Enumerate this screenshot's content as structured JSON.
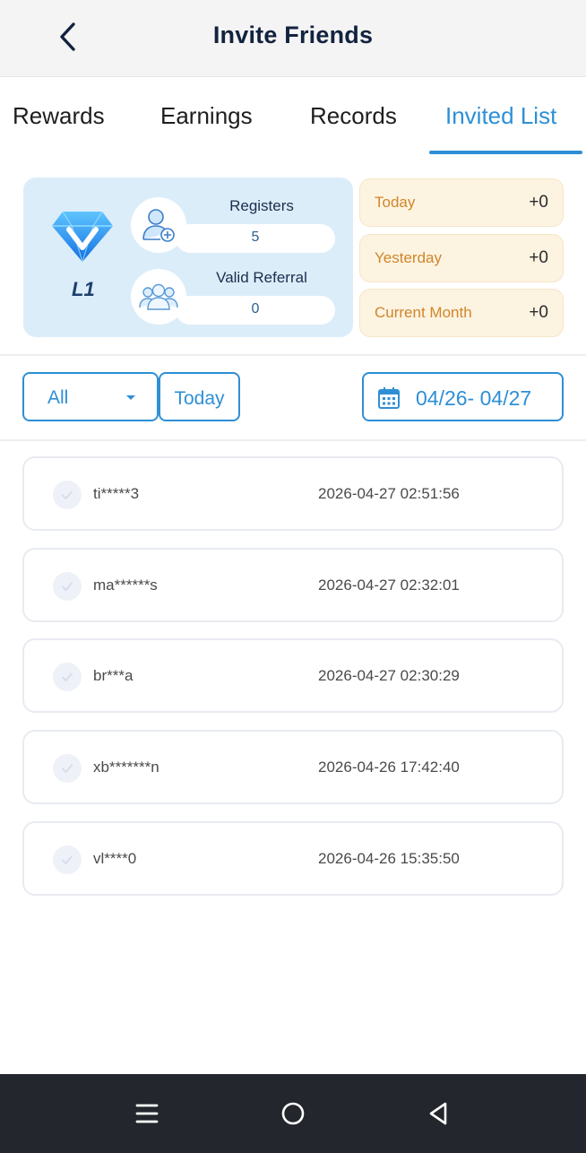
{
  "header": {
    "title": "Invite Friends",
    "back_icon": "chevron-left-icon"
  },
  "tabs": [
    {
      "label": "Rewards",
      "active": false
    },
    {
      "label": "Earnings",
      "active": false
    },
    {
      "label": "Records",
      "active": false
    },
    {
      "label": "Invited List",
      "active": true
    }
  ],
  "level": {
    "label": "L1",
    "icon": "diamond-icon"
  },
  "stats": {
    "registers": {
      "label": "Registers",
      "value": "5",
      "icon": "add-user-icon"
    },
    "valid_referral": {
      "label": "Valid Referral",
      "value": "0",
      "icon": "users-group-icon"
    }
  },
  "periods": [
    {
      "label": "Today",
      "value": "+0"
    },
    {
      "label": "Yesterday",
      "value": "+0"
    },
    {
      "label": "Current Month",
      "value": "+0"
    }
  ],
  "filters": {
    "select_value": "All",
    "today_label": "Today",
    "date_range": "04/26- 04/27",
    "calendar_icon": "calendar-icon"
  },
  "invited": [
    {
      "name": "ti*****3",
      "time": "2026-04-27 02:51:56"
    },
    {
      "name": "ma******s",
      "time": "2026-04-27 02:32:01"
    },
    {
      "name": "br***a",
      "time": "2026-04-27 02:30:29"
    },
    {
      "name": "xb*******n",
      "time": "2026-04-26 17:42:40"
    },
    {
      "name": "vl****0",
      "time": "2026-04-26 15:35:50"
    }
  ],
  "colors": {
    "accent": "#2e8fd6",
    "period_text": "#d0862a",
    "card_bg": "#dcedfa"
  },
  "system_nav": [
    "menu-icon",
    "home-circle-icon",
    "back-triangle-icon"
  ]
}
